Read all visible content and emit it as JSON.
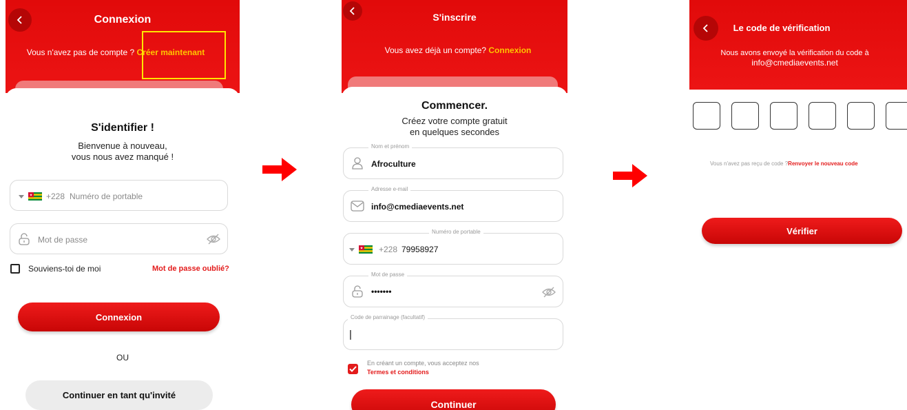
{
  "login": {
    "header_title": "Connexion",
    "no_account_text": "Vous n'avez pas de compte ?",
    "create_link": "Créer maintenant",
    "heading": "S'identifier !",
    "welcome_line1": "Bienvenue à nouveau,",
    "welcome_line2": "vous nous avez manqué !",
    "country_code": "+228",
    "phone_placeholder": "Numéro de portable",
    "password_placeholder": "Mot de passe",
    "remember_me": "Souviens-toi de moi",
    "forgot_password": "Mot de passe oublié?",
    "login_button": "Connexion",
    "or_text": "OU",
    "guest_button": "Continuer en tant qu'invité"
  },
  "signup": {
    "header_title": "S'inscrire",
    "have_account_text": "Vous avez déjà un compte?",
    "login_link": "Connexion",
    "heading": "Commencer.",
    "sub_line1": "Créez votre compte gratuit",
    "sub_line2": "en quelques secondes",
    "name_label": "Nom et prénom",
    "name_value": "Afroculture",
    "email_label": "Adresse e-mail",
    "email_value": "info@cmediaevents.net",
    "phone_label": "Numéro de portable",
    "country_code": "+228",
    "phone_value": "79958927",
    "password_label": "Mot de passe",
    "password_value": "•••••••",
    "referral_label": "Code de parrainage (facultatif)",
    "referral_value": "|",
    "terms_text": "En créant un compte, vous acceptez nos",
    "terms_link": "Termes et conditions",
    "continue_button": "Continuer"
  },
  "verify": {
    "header_title": "Le code de vérification",
    "sent_line1": "Nous avons envoyé la vérification du code à",
    "sent_line2": "info@cmediaevents.net",
    "not_received": "Vous n'avez pas reçu de code ?",
    "resend_link": "Renvoyer le nouveau code",
    "verify_button": "Vérifier"
  },
  "colors": {
    "brand_red": "#e10a0a",
    "link_yellow": "#ffc400",
    "highlight_yellow": "#ffe600",
    "accent_red": "#e31b1b"
  }
}
